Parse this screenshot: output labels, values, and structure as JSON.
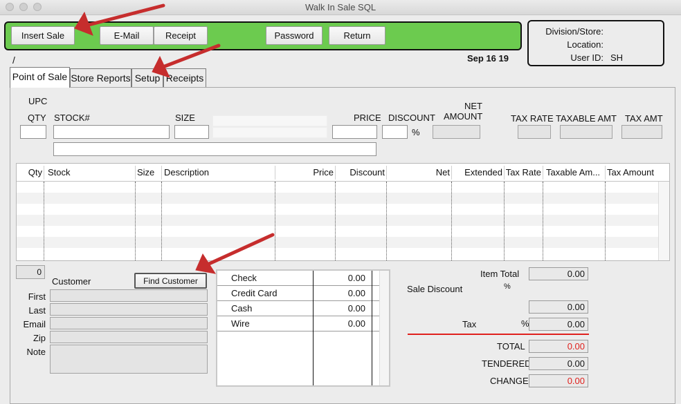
{
  "window": {
    "title": "Walk In Sale SQL"
  },
  "toolbar": {
    "insert_sale": "Insert Sale",
    "email": "E-Mail",
    "receipt": "Receipt",
    "password": "Password",
    "return": "Return"
  },
  "store_info": {
    "division_label": "Division/Store:",
    "division_value": "",
    "location_label": "Location:",
    "location_value": "",
    "user_label": "User ID:",
    "user_value": "SH"
  },
  "slash": "/",
  "date": "Sep 16 19",
  "tabs": [
    {
      "label": "Point of Sale",
      "active": true
    },
    {
      "label": "Store Reports"
    },
    {
      "label": "Setup"
    },
    {
      "label": "Receipts"
    }
  ],
  "entry": {
    "upc_label": "UPC",
    "qty_label": "QTY",
    "stock_label": "STOCK#",
    "size_label": "SIZE",
    "price_label": "PRICE",
    "discount_label": "DISCOUNT",
    "percent": "%",
    "net_label_1": "NET",
    "net_label_2": "AMOUNT",
    "tax_rate_label": "TAX RATE",
    "taxable_label": "TAXABLE AMT",
    "tax_amt_label": "TAX AMT"
  },
  "grid": {
    "columns": [
      "Qty",
      "Stock",
      "Size",
      "Description",
      "Price",
      "Discount",
      "Net",
      "Extended",
      "Tax Rate",
      "Taxable Am...",
      "Tax Amount"
    ],
    "rows": []
  },
  "count": "0",
  "customer": {
    "title": "Customer",
    "find_button": "Find Customer",
    "first_label": "First",
    "last_label": "Last",
    "email_label": "Email",
    "zip_label": "Zip",
    "note_label": "Note"
  },
  "payments": [
    {
      "method": "Check",
      "amount": "0.00"
    },
    {
      "method": "Credit Card",
      "amount": "0.00"
    },
    {
      "method": "Cash",
      "amount": "0.00"
    },
    {
      "method": "Wire",
      "amount": "0.00"
    }
  ],
  "totals": {
    "item_total_label": "Item Total",
    "item_total": "0.00",
    "sale_discount_label": "Sale Discount",
    "sale_discount_pct": "%",
    "sale_discount": "0.00",
    "tax_label": "Tax",
    "tax_pct": "%",
    "tax": "0.00",
    "total_label": "TOTAL",
    "total": "0.00",
    "tendered_label": "TENDERED",
    "tendered": "0.00",
    "change_label": "CHANGE",
    "change": "0.00"
  },
  "colors": {
    "toolbar_green": "#6ccb4f",
    "annotation_arrow": "#c62d2d",
    "negative_red": "#e0201c"
  }
}
